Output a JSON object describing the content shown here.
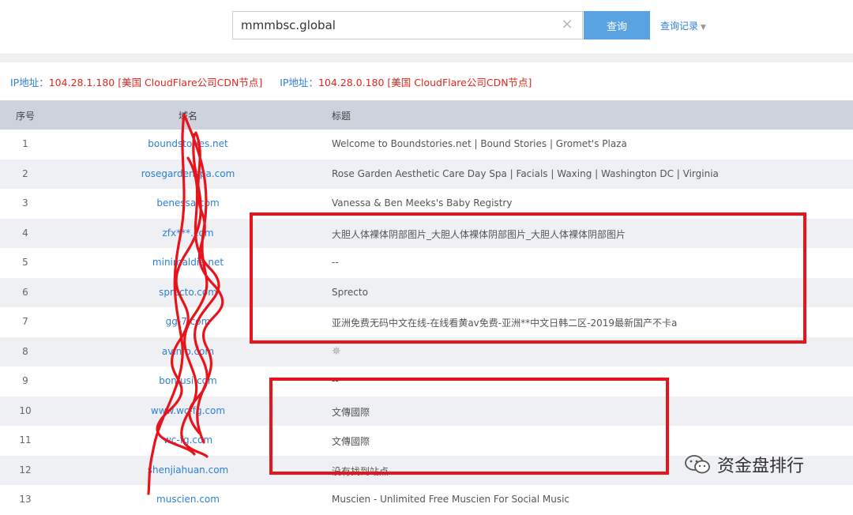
{
  "search": {
    "value": "mmmbsc.global",
    "clear_icon": "×",
    "button_label": "查询",
    "history_label": "查询记录"
  },
  "ip_info": [
    {
      "label": "IP地址：",
      "value": "104.28.1.180 [美国 CloudFlare公司CDN节点]"
    },
    {
      "label": "IP地址：",
      "value": "104.28.0.180 [美国 CloudFlare公司CDN节点]"
    }
  ],
  "table": {
    "headers": {
      "no": "序号",
      "domain": "域名",
      "title": "标题"
    },
    "rows": [
      {
        "no": "1",
        "domain": "boundstories.net",
        "title": "Welcome to Boundstories.net | Bound Stories | Gromet's Plaza"
      },
      {
        "no": "2",
        "domain": "rosegardenspa.com",
        "title": "Rose Garden Aesthetic Care Day Spa | Facials | Waxing | Washington DC | Virginia"
      },
      {
        "no": "3",
        "domain": "benessa.com",
        "title": "Vanessa & Ben Meeks's Baby Registry"
      },
      {
        "no": "4",
        "domain": "zfx***.com",
        "title": "大胆人体裸体阴部图片_大胆人体裸体阴部图片_大胆人体裸体阴部图片"
      },
      {
        "no": "5",
        "domain": "minimaldia.net",
        "title": "--"
      },
      {
        "no": "6",
        "domain": "sprecto.com",
        "title": "Sprecto"
      },
      {
        "no": "7",
        "domain": "gg-7.com",
        "title": "亚洲免费无码中文在线-在线看黄av免费-亚洲**中文日韩二区-2019最新国产不卡a"
      },
      {
        "no": "8",
        "domain": "avinfo.com",
        "title": ""
      },
      {
        "no": "9",
        "domain": "bonfusi.com",
        "title": "--"
      },
      {
        "no": "10",
        "domain": "www.wc-fg.com",
        "title": "文傳國際"
      },
      {
        "no": "11",
        "domain": "wc-fg.com",
        "title": "文傳國際"
      },
      {
        "no": "12",
        "domain": "shenjiahuan.com",
        "title": "没有找到站点"
      },
      {
        "no": "13",
        "domain": "muscien.com",
        "title": "Muscien - Unlimited Free Muscien For Social Music"
      }
    ]
  },
  "watermark": {
    "text": "资金盘排行",
    "icon": "wechat-icon"
  },
  "colors": {
    "accent": "#5aa3e3",
    "link": "#2d7fd2",
    "ip_value": "#e0271f",
    "annotation": "#e8141b",
    "header_bg": "#cdd2dd"
  }
}
